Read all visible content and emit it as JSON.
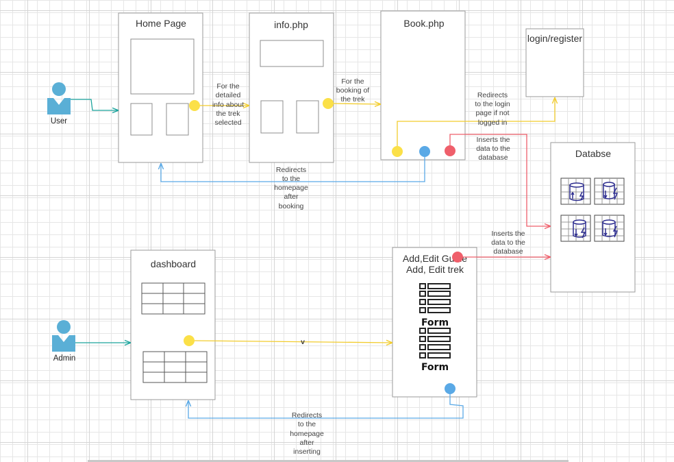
{
  "actors": {
    "user": "User",
    "admin": "Admin"
  },
  "pages": {
    "home": "Home Page",
    "info": "info.php",
    "book": "Book.php",
    "login": "login/register",
    "database": "Databse",
    "dashboard": "dashboard",
    "add_edit_line1": "Add,Edit Guide",
    "add_edit_line2": "Add, Edit trek"
  },
  "forms": [
    "Form",
    "Form"
  ],
  "notes": {
    "detailed_info": [
      "For the",
      "detailed",
      "info about",
      "the trek",
      "selected"
    ],
    "booking": [
      "For the",
      "booking of",
      "the trek"
    ],
    "redirect_login": [
      "Redirects",
      "to the login",
      "page if not",
      "logged in"
    ],
    "inserts_top": [
      "Inserts the",
      "data to the",
      "database"
    ],
    "inserts_bottom": [
      "Inserts the",
      "data to the",
      "database"
    ],
    "redirect_after_booking": [
      "Redirects",
      "to the",
      "homepage",
      "after",
      "booking"
    ],
    "redirect_after_inserting": [
      "Redirects",
      "to the",
      "homepage",
      "after",
      "inserting"
    ],
    "arrow_v": "v"
  },
  "colors": {
    "teal": "#1ba39c",
    "yellow": "#fbe048",
    "blue": "#5aa9e6",
    "red": "#ef5f6b",
    "actor": "#5aafd6",
    "db_icon": "#2d2d8f"
  }
}
